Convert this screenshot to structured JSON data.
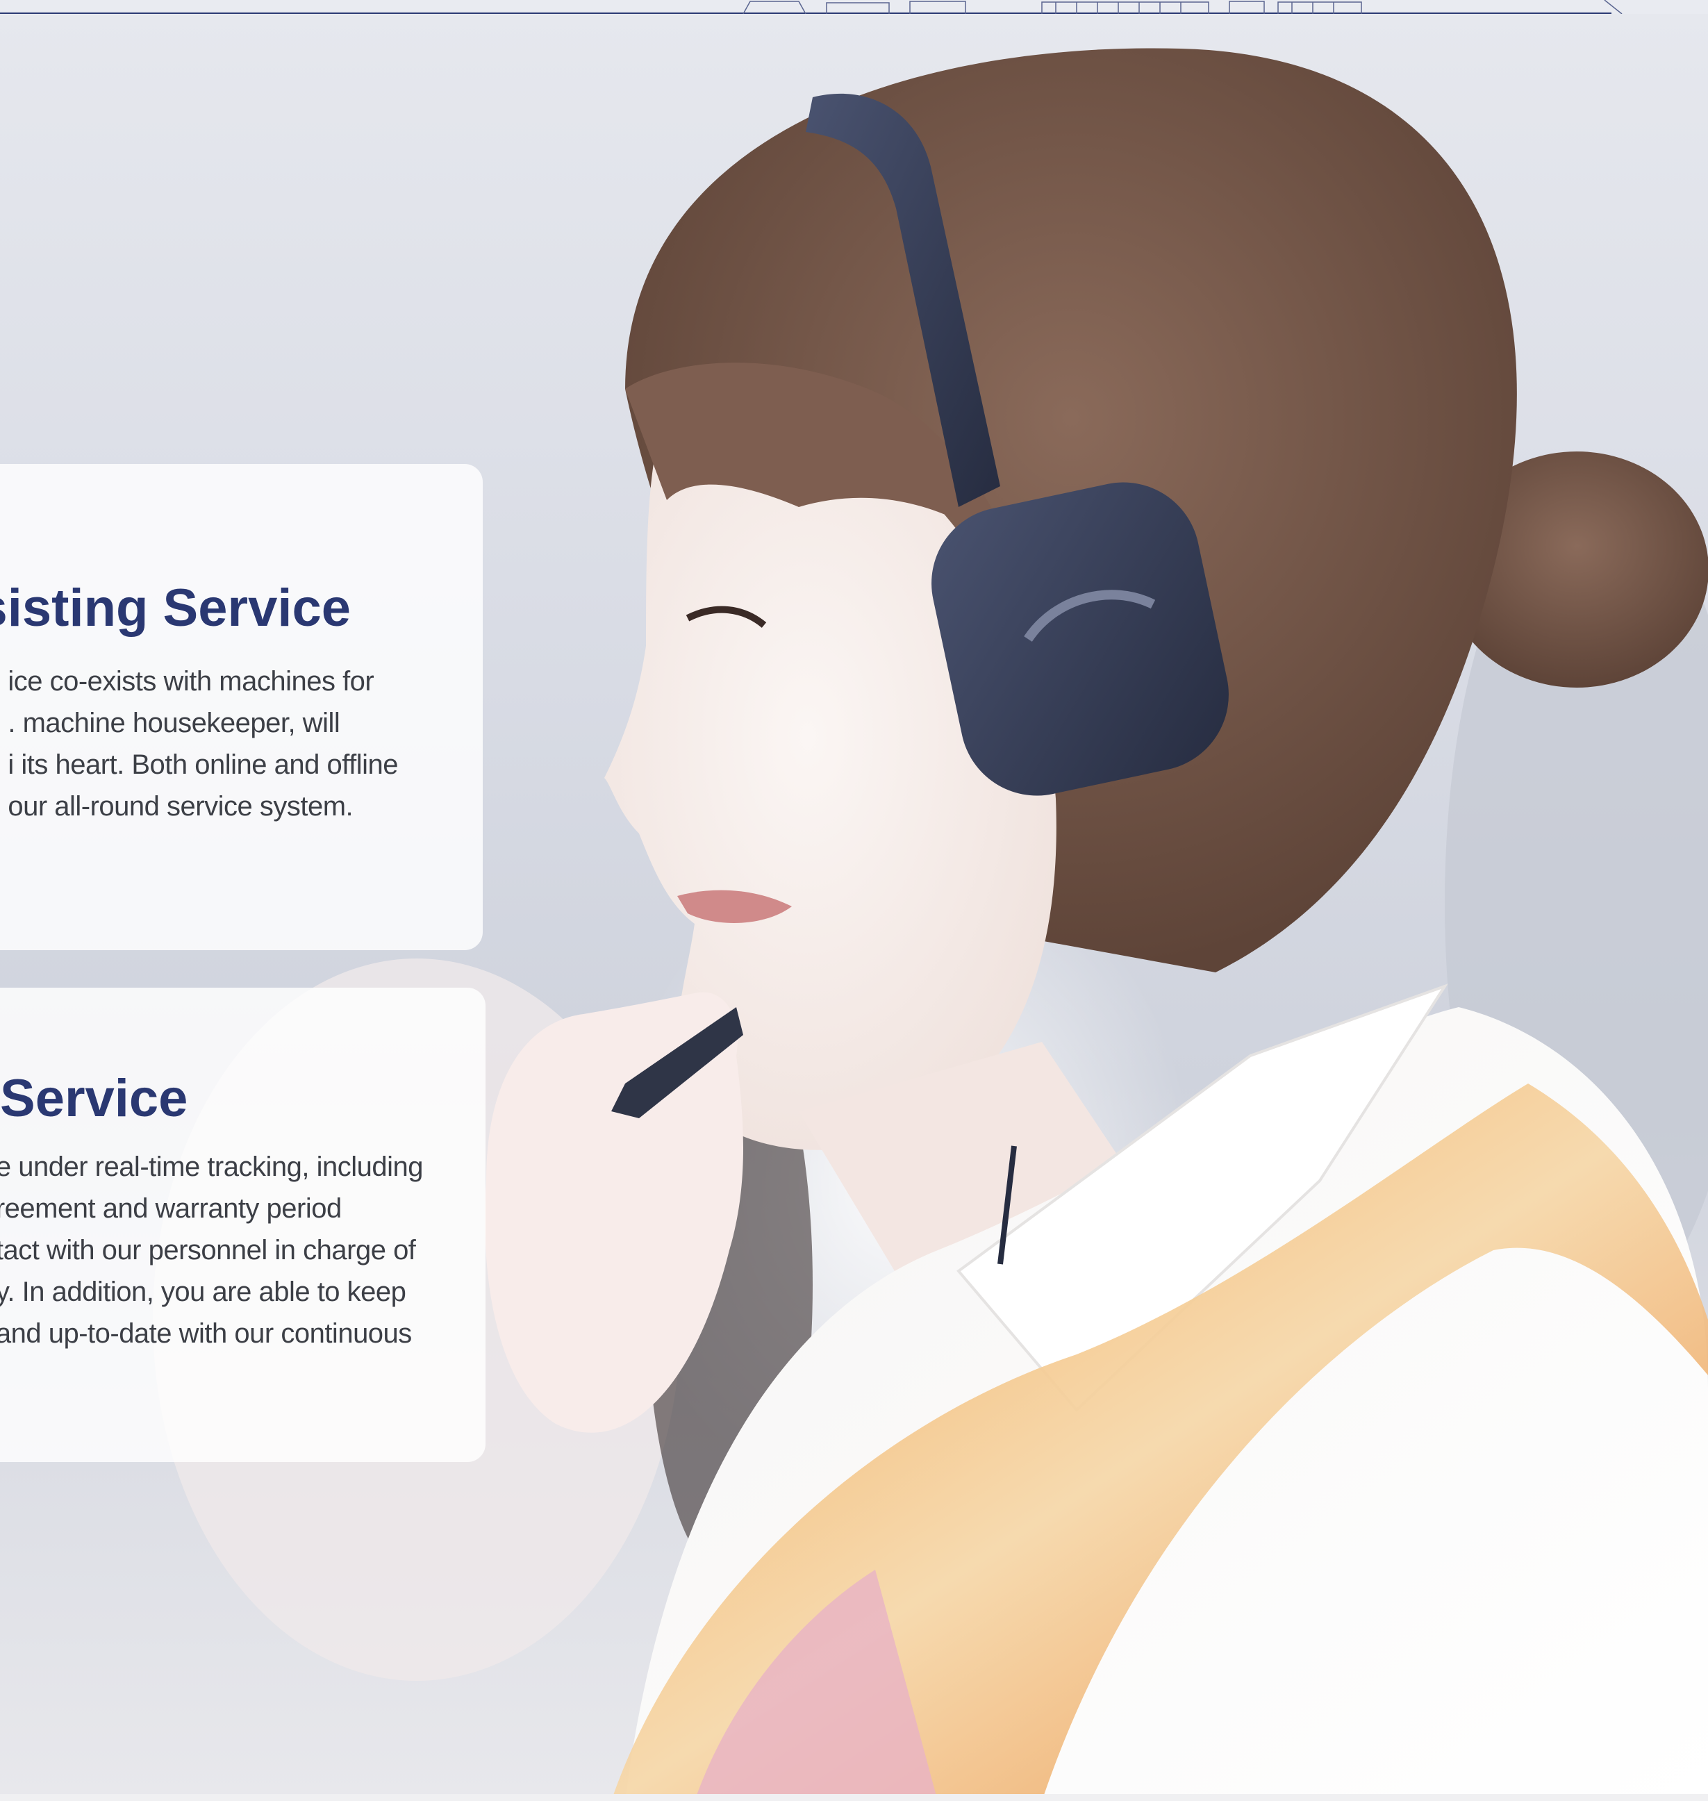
{
  "colors": {
    "heading": "#2a3872",
    "body_text": "#3c3f46",
    "rule": "#2c3a74",
    "card_bg": "rgba(255,255,255,0.82)"
  },
  "photo": {
    "subject": "customer-service-agent-with-headset-photo"
  },
  "card_1": {
    "title": "Assisting Service",
    "lines": [
      "ice co-exists with machines for",
      ". machine housekeeper, will",
      "i its heart. Both online and offline",
      "our all-round service system."
    ]
  },
  "card_2": {
    "title": "Service",
    "lines": [
      "e under real-time tracking, including",
      "reement and warranty period",
      "tact with our personnel in charge of",
      "y. In addition, you are able to keep",
      "and up-to-date with our continuous"
    ]
  }
}
